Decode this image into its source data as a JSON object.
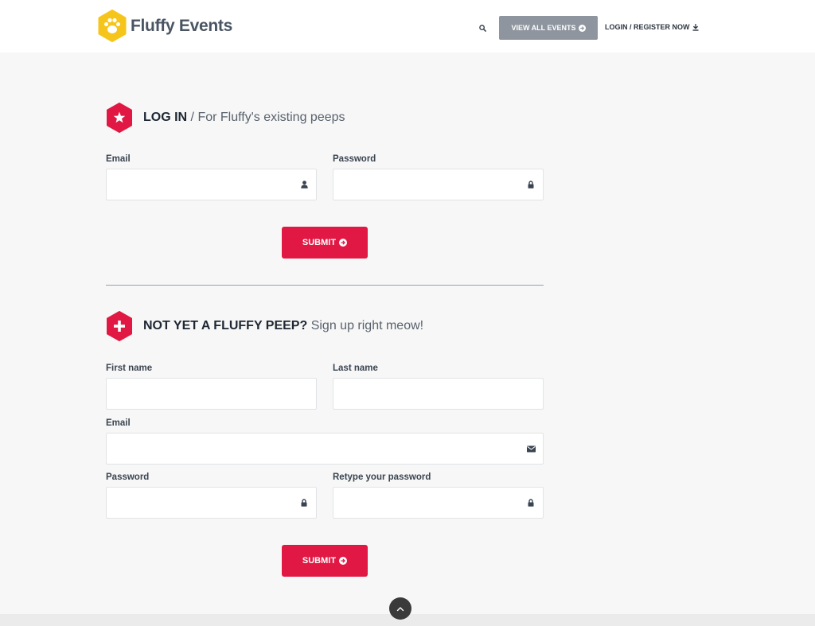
{
  "brand": {
    "name": "Fluffy Events",
    "logo_color": "#f6c51b"
  },
  "nav": {
    "search_icon": "search-icon",
    "view_all_label": "VIEW ALL EVENTS",
    "login_label": "LOGIN / REGISTER NOW"
  },
  "login": {
    "title": "LOG IN",
    "subtitle": " / For Fluffy's existing peeps",
    "email_label": "Email",
    "email_value": "",
    "password_label": "Password",
    "password_value": "",
    "submit_label": "SUBMIT"
  },
  "signup": {
    "title": "NOT YET A FLUFFY PEEP?",
    "subtitle": " Sign up right meow!",
    "first_name_label": "First name",
    "first_name_value": "",
    "last_name_label": "Last name",
    "last_name_value": "",
    "email_label": "Email",
    "email_value": "",
    "password_label": "Password",
    "password_value": "",
    "retype_label": "Retype your password",
    "retype_value": "",
    "submit_label": "SUBMIT"
  },
  "colors": {
    "accent": "#e01843",
    "button_gray": "#8e959e",
    "background": "#f7f7f7"
  }
}
